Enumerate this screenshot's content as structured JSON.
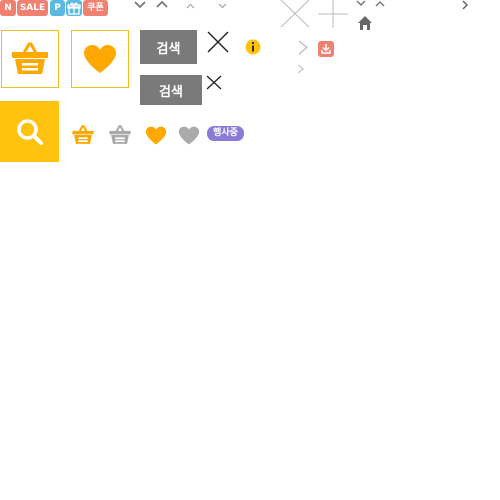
{
  "badges": {
    "new": "N",
    "sale": "SALE",
    "point": "P",
    "coupon": "쿠폰"
  },
  "buttons": {
    "search_1": "검색",
    "search_2": "검색"
  },
  "event_badge": "행사중",
  "colors": {
    "orange": "#ffa800",
    "yellow": "#ffc20e",
    "salmon": "#f08070",
    "teal": "#5cb8e0",
    "gray_button": "#7a7a7a",
    "gray_icon": "#aaaaaa",
    "purple": "#8b7bd8"
  },
  "icons": [
    "chevron-down-icon",
    "chevron-up-icon",
    "chevron-right-icon",
    "close-icon",
    "plus-icon",
    "home-icon",
    "info-icon",
    "download-icon",
    "basket-icon",
    "heart-icon",
    "search-icon",
    "gift-icon"
  ]
}
